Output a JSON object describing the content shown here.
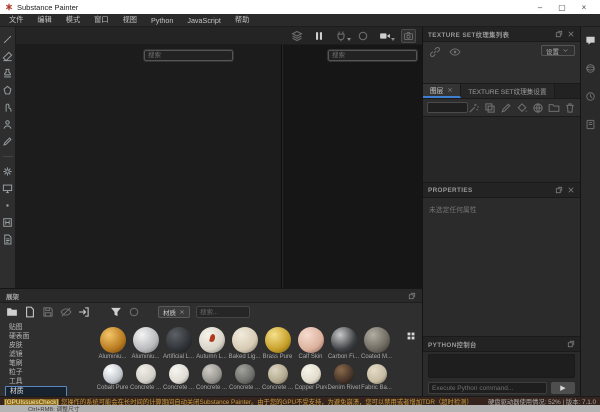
{
  "window": {
    "title": "Substance Painter",
    "controls": {
      "minimize": "–",
      "maximize": "▢",
      "close": "×"
    }
  },
  "menu": {
    "items": [
      "文件",
      "编辑",
      "模式",
      "窗口",
      "视图",
      "Python",
      "JavaScript",
      "帮助"
    ]
  },
  "left_toolbar": {
    "tools": [
      {
        "name": "paint-tool-button",
        "icon": "brush"
      },
      {
        "name": "eraser-tool-button",
        "icon": "eraser"
      },
      {
        "name": "projection-tool-button",
        "icon": "stamp"
      },
      {
        "name": "polygon-fill-tool-button",
        "icon": "polyfill"
      },
      {
        "name": "smudge-tool-button",
        "icon": "smudge"
      },
      {
        "name": "clone-tool-button",
        "icon": "person"
      },
      {
        "name": "material-picker-tool-button",
        "icon": "pen"
      },
      {
        "sep": true
      },
      {
        "name": "settings-button",
        "icon": "gear",
        "dim": true
      },
      {
        "name": "display-button",
        "icon": "monitor",
        "dim": true
      },
      {
        "name": "dot-button",
        "icon": "dot",
        "dim": true
      },
      {
        "name": "plugin-button",
        "icon": "plugin"
      },
      {
        "name": "resources-button",
        "icon": "docfile"
      }
    ]
  },
  "viewport": {
    "search_placeholder": "搜索",
    "toolbar": [
      {
        "name": "scene-layers-button",
        "icon": "layers",
        "dim": true
      },
      {
        "name": "pause-engine-button",
        "icon": "pause"
      },
      {
        "name": "connection-button",
        "icon": "plug",
        "dim": true,
        "caret": true
      },
      {
        "name": "render-mode-button",
        "icon": "circleo",
        "dim": true
      },
      {
        "name": "camera-video-button",
        "icon": "camcorder",
        "caret": true
      },
      {
        "name": "camera-button",
        "icon": "camera",
        "dim": true,
        "boxed": true
      }
    ]
  },
  "texture_set_list": {
    "title": "TEXTURE SET纹理集列表",
    "dropdown_label": "设置",
    "icons": [
      {
        "name": "link-texture-sets-button",
        "icon": "link",
        "dim": true
      },
      {
        "name": "texture-set-visibility-button",
        "icon": "eye",
        "dim": true
      }
    ]
  },
  "tabs": {
    "layers_label": "图层",
    "texture_set_settings_label": "TEXTURE SET纹理集设置"
  },
  "layers_panel": {
    "toolbar": [
      {
        "name": "add-effect-button",
        "icon": "wand",
        "dim": true
      },
      {
        "name": "add-instance-button",
        "icon": "copy",
        "dim": true
      },
      {
        "name": "add-paint-layer-button",
        "icon": "pen",
        "dim": true
      },
      {
        "name": "add-fill-layer-button",
        "icon": "bucket",
        "dim": true
      },
      {
        "name": "add-smart-material-button",
        "icon": "globe",
        "dim": true
      },
      {
        "name": "add-folder-button",
        "icon": "folderline",
        "dim": true
      },
      {
        "name": "delete-layer-button",
        "icon": "trash",
        "dim": true
      }
    ]
  },
  "properties": {
    "title": "PROPERTIES",
    "empty_text": "未选定任何属性"
  },
  "python_console": {
    "title": "PYTHON控制台",
    "input_placeholder": "Execute Python command...",
    "run_glyph": "▶"
  },
  "dock": {
    "icons": [
      {
        "name": "notifications-panel-button",
        "icon": "chat"
      },
      {
        "name": "display-settings-button",
        "icon": "sphere",
        "dim": true
      },
      {
        "name": "history-button",
        "icon": "clock",
        "dim": true
      },
      {
        "name": "log-button",
        "icon": "card",
        "dim": true
      }
    ]
  },
  "shelf": {
    "title": "展架",
    "toolbar": [
      {
        "name": "open-shelf-folder-button",
        "icon": "folder"
      },
      {
        "name": "new-resource-button",
        "icon": "filenew"
      },
      {
        "name": "save-resources-button",
        "icon": "save",
        "dim": true
      },
      {
        "name": "toggle-hidden-button",
        "icon": "eyeoff",
        "dim": true
      },
      {
        "name": "import-resources-button",
        "icon": "importres"
      }
    ],
    "filter_icons": [
      {
        "name": "filter-button",
        "icon": "funnel"
      },
      {
        "name": "filter-state-button",
        "icon": "circleo",
        "dim": true
      }
    ],
    "filter_tag": "材质",
    "search_placeholder": "搜索...",
    "categories": [
      "贴图",
      "硬表面",
      "皮肤",
      "滤镜",
      "笔刷",
      "粒子",
      "工具",
      "材质"
    ],
    "selected_category": "材质",
    "materials_row1": [
      {
        "label": "Aluminiu...",
        "c": [
          "#f5c667",
          "#b87a20",
          "#5e3a08"
        ]
      },
      {
        "label": "Aluminiu...",
        "c": [
          "#f4f4f4",
          "#b9babc",
          "#5f6164"
        ]
      },
      {
        "label": "Artificial L...",
        "c": [
          "#5c6166",
          "#2f3236",
          "#141619"
        ]
      },
      {
        "label": "Autumn L...",
        "c": [
          "#f7f4ec",
          "#d9d4c8",
          "#6e6a60"
        ],
        "accent": "#b0391c"
      },
      {
        "label": "Baked Lig...",
        "c": [
          "#f2ebdc",
          "#d6cbb4",
          "#6f6450"
        ]
      },
      {
        "label": "Brass Pure",
        "c": [
          "#f6e08c",
          "#c7a02a",
          "#6b520e"
        ]
      },
      {
        "label": "Calf Skin",
        "c": [
          "#f6dccf",
          "#dcb19e",
          "#74503f"
        ]
      },
      {
        "label": "Carbon Fi...",
        "c": [
          "#c8c8c8",
          "#3e4144",
          "#101214"
        ]
      },
      {
        "label": "Coated M...",
        "c": [
          "#b2aea2",
          "#6e6a60",
          "#2e2b24"
        ]
      }
    ],
    "materials_row2": [
      {
        "label": "Cobalt Pure",
        "c": [
          "#ffffff",
          "#c2c7cc",
          "#595e63"
        ]
      },
      {
        "label": "Concrete ...",
        "c": [
          "#f0eee7",
          "#d2d0c8",
          "#6b6a62"
        ]
      },
      {
        "label": "Concrete ...",
        "c": [
          "#f6f5f0",
          "#dedcd4",
          "#73726a"
        ]
      },
      {
        "label": "Concrete ...",
        "c": [
          "#cfcdc6",
          "#989690",
          "#45443f"
        ]
      },
      {
        "label": "Concrete ...",
        "c": [
          "#a3a39e",
          "#6e6e6a",
          "#2e2e2b"
        ]
      },
      {
        "label": "Concrete ...",
        "c": [
          "#ddd5c0",
          "#b3a98f",
          "#554e3c"
        ]
      },
      {
        "label": "Copper Pure",
        "c": [
          "#f8f5ea",
          "#e0dbcc",
          "#746e5c"
        ]
      },
      {
        "label": "Denim Rivet",
        "c": [
          "#8a6a4a",
          "#47342a",
          "#140e0a"
        ]
      },
      {
        "label": "Fabric Ba...",
        "c": [
          "#e5dcc6",
          "#c6bca2",
          "#5c5542"
        ]
      }
    ]
  },
  "status_bar": {
    "warning_tag": "[GPUIssuesCheck]",
    "warning_text": " 您操作的系统可能会在长时间的计算期间自动关闭Substance Painter。由于您的GPU不受支持，为避免崩溃，您可以禁用或者增加TDR（超时检测）",
    "usage_text": "硬盘驱动器使用情况: 52% | 版本: 7.1.0",
    "hint": "Ctrl+RMB: 调整尺寸"
  },
  "colors": {
    "accent_blue": "#3f7fd2",
    "warning_yellow": "#cf9e3c",
    "titlebar_bg": "#ffffff",
    "panel_bg": "#2b2b2b"
  }
}
